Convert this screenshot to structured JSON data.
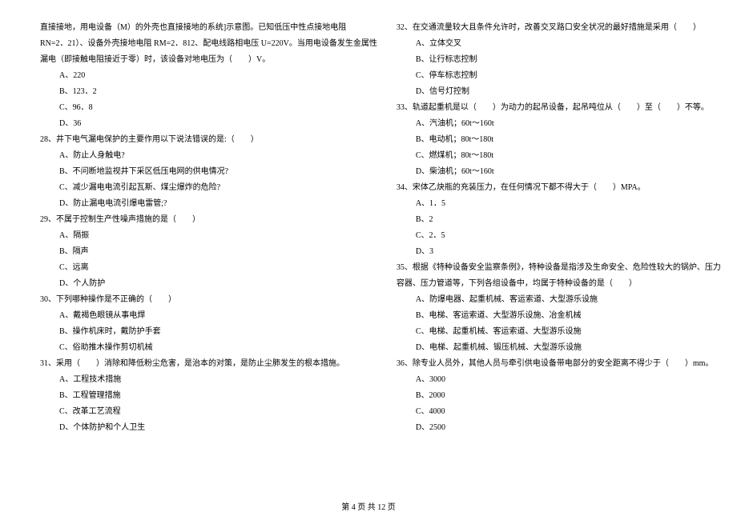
{
  "col_left": {
    "intro": [
      "直接接地，用电设备（M）的外壳也直接接地的系统]示意图。已知低压中性点接地电阻",
      "RN=2．21）、设备外壳接地电阻 RM=2．812、配电线路相电压 U=220V。当用电设备发生金属性",
      "漏电（即接触电阻接近于零）时，该设备对地电压为（　　）V。"
    ],
    "q27_opts": {
      "a": "A、220",
      "b": "B、123．2",
      "c": "C、96．8",
      "d": "D、36"
    },
    "q28": "28、井下电气漏电保护的主要作用以下说法错误的是:（　　）",
    "q28_opts": {
      "a": "A、防止人身触电?",
      "b": "B、不问断地监视井下采区低压电网的供电情况?",
      "c": "C、减少漏电电流引起瓦斯、煤尘爆炸的危险?",
      "d": "D、防止漏电电流引爆电雷管;?"
    },
    "q29": "29、不属于控制生产性噪声措施的是（　　）",
    "q29_opts": {
      "a": "A、隔振",
      "b": "B、隔声",
      "c": "C、远离",
      "d": "D、个人防护"
    },
    "q30": "30、下列哪种操作是不正确的（　　）",
    "q30_opts": {
      "a": "A、戴褐色眼镜从事电焊",
      "b": "B、操作机床时，戴防护手套",
      "c": "C、俗助推木操作剪切机械"
    },
    "q31": "31、采用（　　）消除和降低粉尘危害，是治本的对策，是防止尘肺发生的根本措施。",
    "q31_opts": {
      "a": "A、工程技术措施",
      "b": "B、工程管理措施",
      "c": "C、改革工艺流程",
      "d": "D、个体防护和个人卫生"
    }
  },
  "col_right": {
    "q32": "32、在交通流量较大且条件允许时，改善交叉路口安全状况的最好措施是采用（　　）",
    "q32_opts": {
      "a": "A、立体交叉",
      "b": "B、让行标志控制",
      "c": "C、停车标志控制",
      "d": "D、信号灯控制"
    },
    "q33": "33、轨道起重机是以（　　）为动力的起吊设备，起吊吨位从（　　）至（　　）不等。",
    "q33_opts": {
      "a": "A、汽油机；60t～160t",
      "b": "B、电动机；80t～180t",
      "c": "C、燃煤机；80t～180t",
      "d": "D、柴油机；60t～160t"
    },
    "q34": "34、宋体乙炔瓶的充装压力，在任何情况下都不得大于（　　）MPA。",
    "q34_opts": {
      "a": "A、1．5",
      "b": "B、2",
      "c": "C、2．5",
      "d": "D、3"
    },
    "q35": "35、根据《特种设备安全监察条例》，特种设备是指涉及生命安全、危险性较大的锅炉、压力",
    "q35_line2": "容器、压力管道等，下列各组设备中，均属于特种设备的是（　　）",
    "q35_opts": {
      "a": "A、防爆电器、起重机械、客运索道、大型游乐设施",
      "b": "B、电梯、客运索道、大型游乐设施、冶金机械",
      "c": "C、电梯、起重机械、客运索道、大型游乐设施",
      "d": "D、电梯、起重机械、锻压机械、大型游乐设施"
    },
    "q36": "36、除专业人员外，其他人员与牵引供电设备带电部分的安全距离不得少于（　　）mm。",
    "q36_opts": {
      "a": "A、3000",
      "b": "B、2000",
      "c": "C、4000",
      "d": "D、2500"
    }
  },
  "footer": "第 4 页 共 12 页"
}
